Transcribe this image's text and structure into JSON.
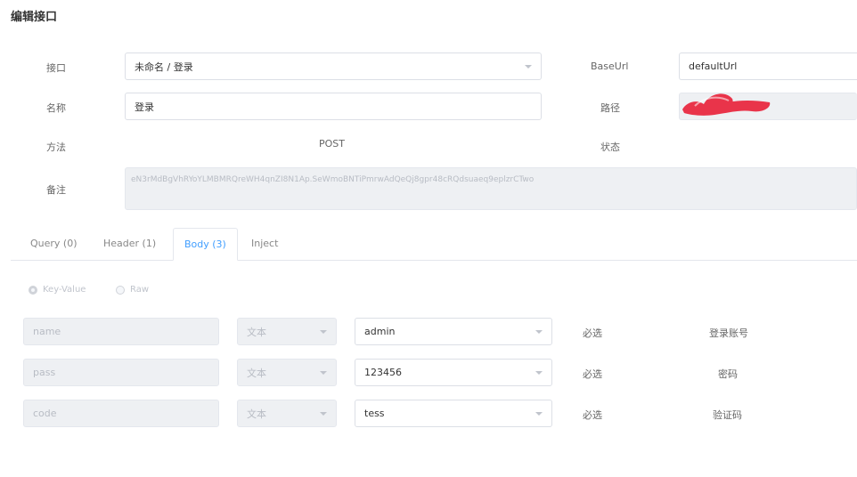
{
  "page": {
    "title": "编辑接口"
  },
  "form": {
    "interface_label": "接口",
    "interface_value": "未命名 / 登录",
    "name_label": "名称",
    "name_value": "登录",
    "method_label": "方法",
    "method_value": "POST",
    "remark_label": "备注",
    "remark_value": "eN3rMdBgVhRYoYLMBMRQreWH4qnZI8N1Ap.SeWmoBNTiPmrwAdQeQj8gpr48cRQdsuaeq9eplzrCTwo",
    "baseurl_label": "BaseUrl",
    "baseurl_value": "defaultUrl",
    "path_label": "路径",
    "status_label": "状态"
  },
  "tabs": [
    {
      "label": "Query (0)"
    },
    {
      "label": "Header (1)"
    },
    {
      "label": "Body (3)"
    },
    {
      "label": "Inject"
    }
  ],
  "body_mode": {
    "option1": "Key-Value",
    "option2": "Raw"
  },
  "params": [
    {
      "key": "name",
      "type": "文本",
      "value": "admin",
      "required": "必选",
      "desc": "登录账号"
    },
    {
      "key": "pass",
      "type": "文本",
      "value": "123456",
      "required": "必选",
      "desc": "密码"
    },
    {
      "key": "code",
      "type": "文本",
      "value": "tess",
      "required": "必选",
      "desc": "验证码"
    }
  ],
  "colors": {
    "accent": "#409eff",
    "redaction": "#e8243c"
  }
}
